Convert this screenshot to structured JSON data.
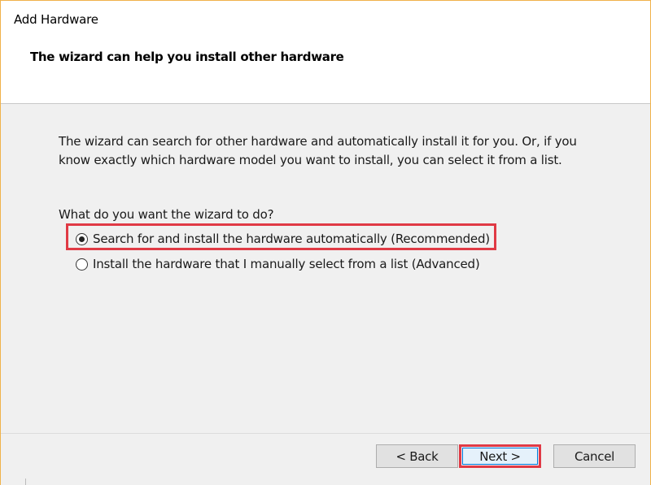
{
  "window": {
    "title": "Add Hardware"
  },
  "header": {
    "heading": "The wizard can help you install other hardware"
  },
  "body": {
    "intro": "The wizard can search for other hardware and automatically install it for you. Or, if you know exactly which hardware model you want to install, you can select it from a list.",
    "question": "What do you want the wizard to do?",
    "options": [
      {
        "label": "Search for and install the hardware automatically (Recommended)",
        "selected": true
      },
      {
        "label": "Install the hardware that I manually select from a list (Advanced)",
        "selected": false
      }
    ]
  },
  "footer": {
    "back_label": "< Back",
    "next_label": "Next >",
    "cancel_label": "Cancel"
  },
  "colors": {
    "highlight": "#e03a45",
    "window_border": "#f0b24a",
    "focus": "#0078d7"
  }
}
